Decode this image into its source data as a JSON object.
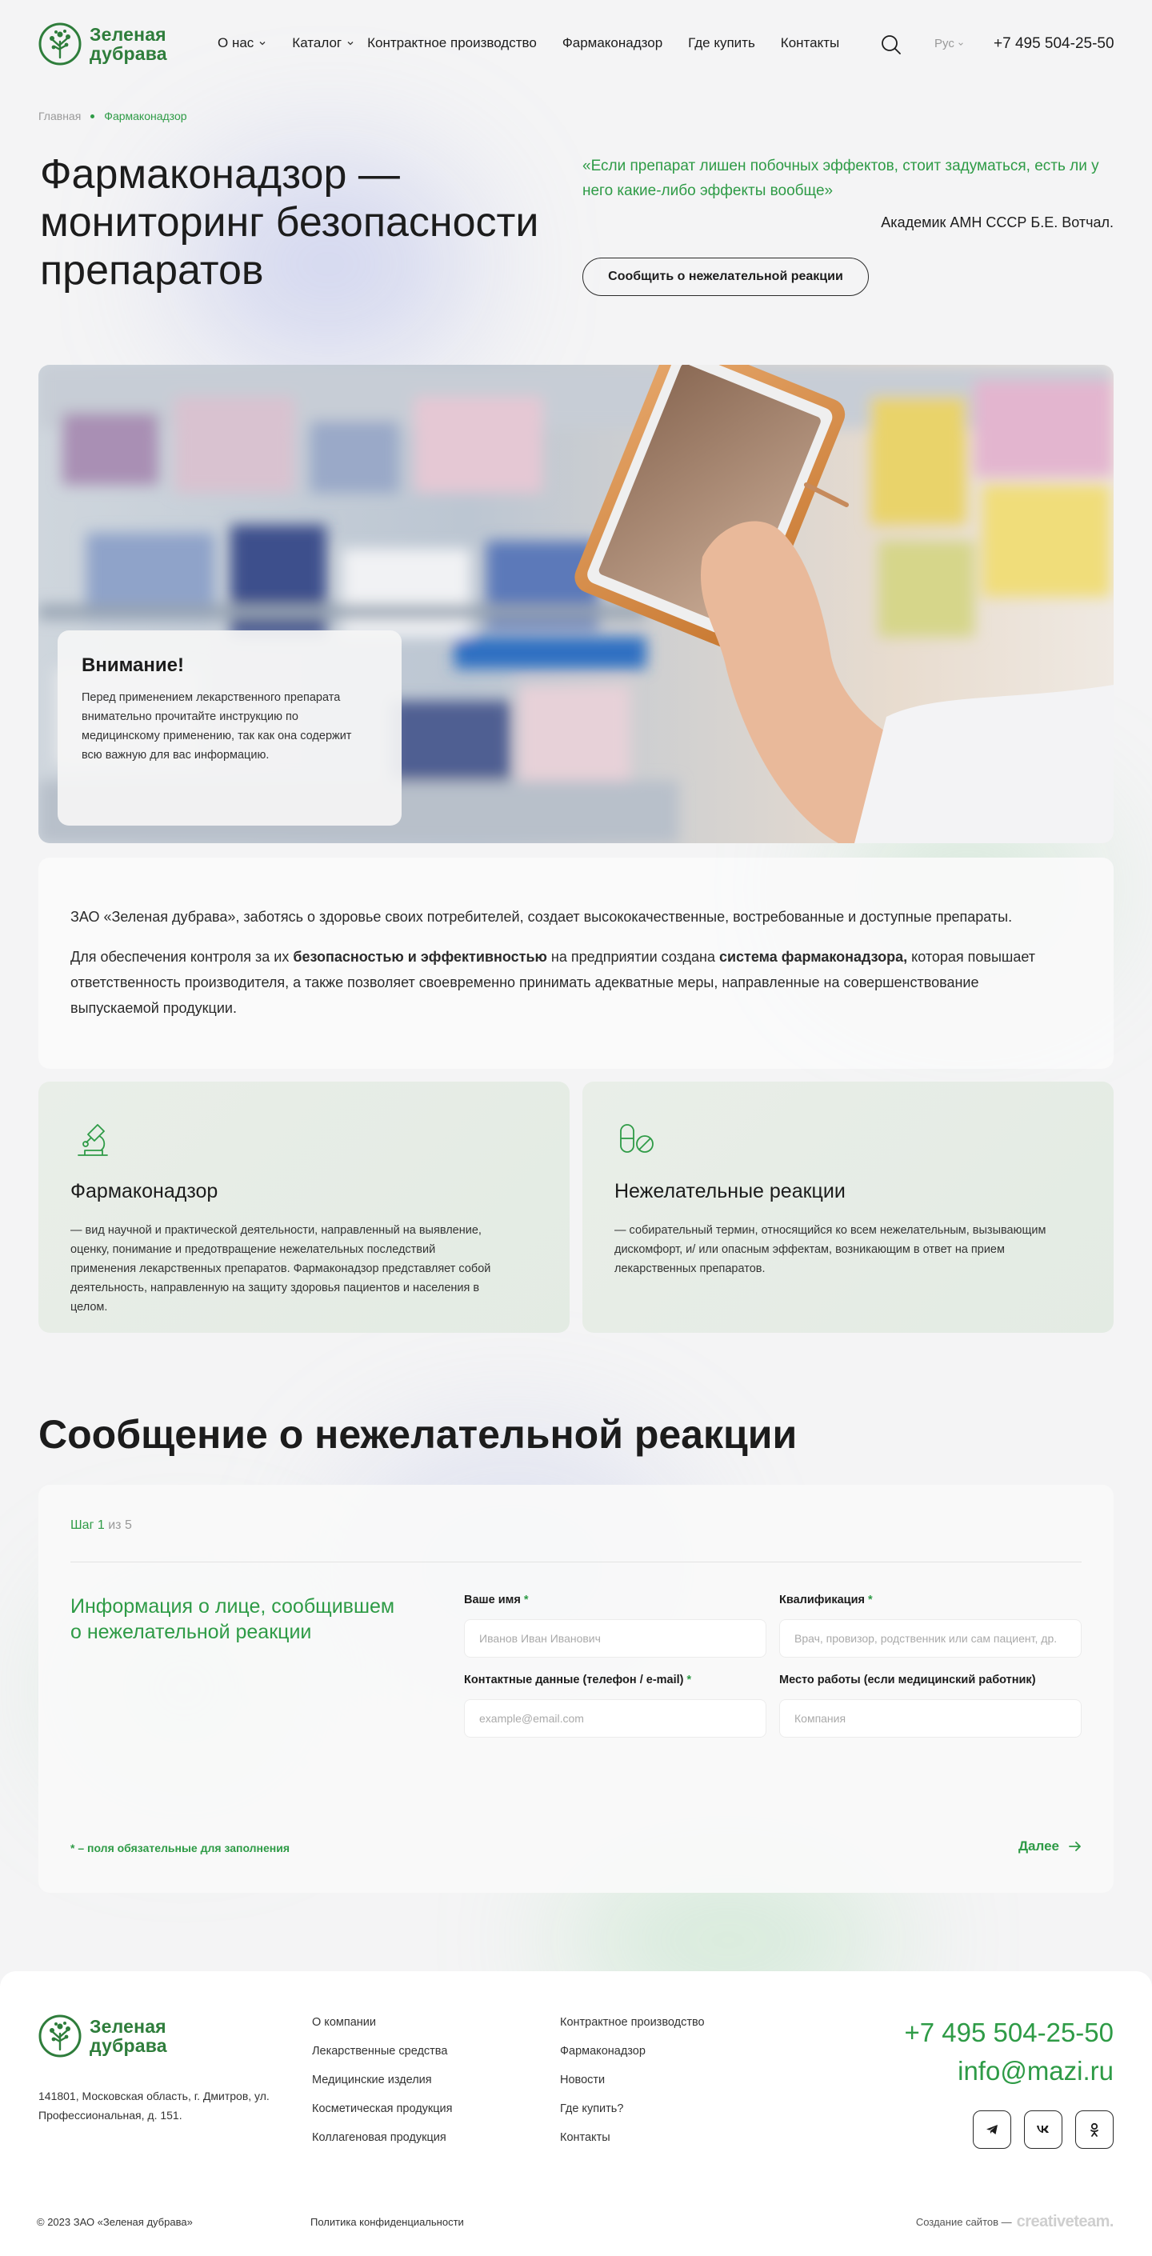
{
  "header": {
    "logo_line1": "Зеленая",
    "logo_line2": "дубрава",
    "nav": [
      {
        "label": "О нас"
      },
      {
        "label": "Каталог"
      },
      {
        "label": "Контрактное производство"
      },
      {
        "label": "Фармаконадзор"
      },
      {
        "label": "Где купить"
      },
      {
        "label": "Контакты"
      }
    ],
    "lang": "Рус",
    "phone": "+7 495 504-25-50"
  },
  "breadcrumb": {
    "home": "Главная",
    "current": "Фармаконадзор"
  },
  "hero": {
    "title": "Фармаконадзор — мониторинг безопасности препаратов",
    "quote": "«Если препарат лишен побочных эффектов, стоит задуматься, есть ли у него какие-либо эффекты вообще»",
    "quote_author": "Академик АМН СССР Б.Е. Вотчал.",
    "report_button": "Сообщить о нежелательной реакции"
  },
  "attention": {
    "title": "Внимание!",
    "text": "Перед применением лекарственного препарата внимательно прочитайте инструкцию по медицинскому применению, так как она содержит всю важную для вас информацию."
  },
  "intro": {
    "p1": "ЗАО «Зеленая дубрава», заботясь о здоровье своих потребителей, создает высококачественные, востребованные и доступные препараты.",
    "p2_a": "Для обеспечения контроля за их ",
    "p2_b": "безопасностью и эффективностью",
    "p2_c": " на предприятии создана ",
    "p2_d": "система фармаконадзора,",
    "p2_e": " которая повышает ответственность производителя, а также позволяет своевременно принимать адекватные меры, направленные на совершенствование выпускаемой продукции."
  },
  "cards": [
    {
      "icon": "microscope-icon",
      "title": "Фармаконадзор",
      "text": "— вид научной и практической деятельности, направленный на выявление, оценку, понимание и предотвращение нежелательных последствий применения лекарственных препаратов. Фармаконадзор представляет собой деятельность, направленную на защиту здоровья пациентов и населения в целом."
    },
    {
      "icon": "pills-icon",
      "title": "Нежелательные реакции",
      "text": "— собирательный термин, относящийся ко всем нежелательным, вызывающим дискомфорт, и/ или опасным эффектам, возникающим в ответ на прием лекарственных препаратов."
    }
  ],
  "form": {
    "title": "Сообщение о нежелательной реакции",
    "step_label": "Шаг",
    "step_current": "1",
    "step_of": "из 5",
    "section_title": "Информация о лице, сообщившем о нежелательной реакции",
    "fields": {
      "name": {
        "label": "Ваше имя",
        "placeholder": "Иванов Иван Иванович"
      },
      "qualification": {
        "label": "Квалификация",
        "placeholder": "Врач, провизор, родственник или сам пациент, др."
      },
      "contacts": {
        "label": "Контактные данные (телефон / e-mail)",
        "placeholder": "example@email.com"
      },
      "workplace": {
        "label": "Место работы (если медицинский работник)",
        "placeholder": "Компания"
      }
    },
    "required_mark": "*",
    "required_note": "* – поля обязательные для заполнения",
    "next_label": "Далее"
  },
  "footer": {
    "address": "141801, Московская область, г. Дмитров, ул. Профессиональная, д. 151.",
    "col1": [
      "О компании",
      "Лекарственные средства",
      "Медицинские изделия",
      "Косметическая продукция",
      "Коллагеновая продукция"
    ],
    "col2": [
      "Контрактное производство",
      "Фармаконадзор",
      "Новости",
      "Где купить?",
      "Контакты"
    ],
    "phone": "+7 495 504-25-50",
    "email": "info@mazi.ru",
    "socials": [
      "telegram-icon",
      "vk-icon",
      "odnoklassniki-icon"
    ],
    "copyright": "© 2023 ЗАО «Зеленая дубрава»",
    "privacy": "Политика конфиденциальности",
    "credit": "Создание сайтов —",
    "credit_brand": "creativeteam."
  },
  "colors": {
    "brand_green": "#2e9b46",
    "dark_green": "#2e7d3b"
  }
}
